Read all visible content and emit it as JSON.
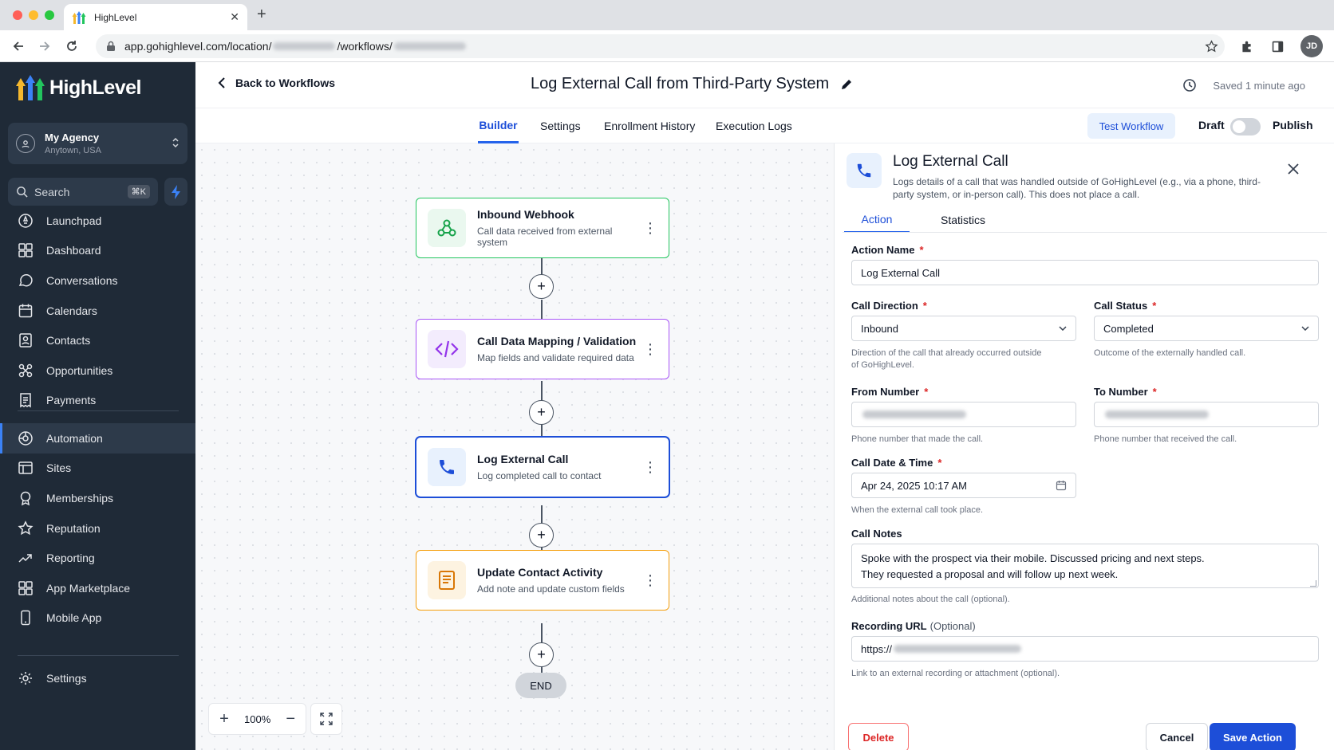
{
  "browser": {
    "tab_title": "HighLevel",
    "tab_close": "✕",
    "new_tab": "+",
    "url_prefix": "app.gohighlevel.com/location/",
    "url_middle": "/workflows/",
    "profile_initials": "JD"
  },
  "sidebar": {
    "brand": "HighLevel",
    "agency_name": "My Agency",
    "agency_location": "Anytown, USA",
    "search_label": "Search",
    "search_shortcut": "⌘K",
    "items_top": [
      {
        "label": "Launchpad",
        "icon": "launchpad-icon"
      },
      {
        "label": "Dashboard",
        "icon": "dashboard-icon"
      },
      {
        "label": "Conversations",
        "icon": "chat-icon"
      },
      {
        "label": "Calendars",
        "icon": "calendar-icon"
      },
      {
        "label": "Contacts",
        "icon": "contacts-icon"
      },
      {
        "label": "Opportunities",
        "icon": "opportunities-icon"
      },
      {
        "label": "Payments",
        "icon": "receipt-icon"
      }
    ],
    "items_mid": [
      {
        "label": "Automation",
        "icon": "automation-icon",
        "active": true
      },
      {
        "label": "Sites",
        "icon": "sites-icon"
      },
      {
        "label": "Memberships",
        "icon": "award-icon"
      },
      {
        "label": "Reputation",
        "icon": "star-icon"
      },
      {
        "label": "Reporting",
        "icon": "trend-icon"
      },
      {
        "label": "App Marketplace",
        "icon": "grid-icon"
      },
      {
        "label": "Mobile App",
        "icon": "mobile-icon"
      }
    ],
    "settings_label": "Settings"
  },
  "header": {
    "back_label": "Back to Workflows",
    "workflow_title": "Log External Call from Third-Party System",
    "saved_status": "Saved 1 minute ago"
  },
  "tabs": {
    "builder": "Builder",
    "settings": "Settings",
    "enrollment_history": "Enrollment History",
    "execution_logs": "Execution Logs",
    "test_workflow": "Test Workflow",
    "draft": "Draft",
    "publish": "Publish",
    "publish_state": "off"
  },
  "canvas": {
    "nodes": [
      {
        "title": "Inbound Webhook",
        "subtitle": "Call data received from external system",
        "icon": "webhook-icon",
        "color": "#22c55e",
        "bg": "#eaf8ef"
      },
      {
        "title": "Call Data Mapping / Validation",
        "subtitle": "Map fields and validate required data",
        "icon": "code-icon",
        "color": "#a855f7",
        "bg": "#f3ecfd"
      },
      {
        "title": "Log External Call",
        "subtitle": "Log completed call to contact",
        "icon": "phone-icon",
        "color": "#1d4ed8",
        "bg": "#e8f1fd"
      },
      {
        "title": "Update Contact Activity",
        "subtitle": "Add note and update custom fields",
        "icon": "note-icon",
        "color": "#f59e0b",
        "bg": "#fdf3e1"
      }
    ],
    "end_label": "END",
    "zoom_level": "100%",
    "plus_symbol": "+",
    "zoom_minus": "−",
    "kebab": "⋮"
  },
  "panel": {
    "title": "Log External Call",
    "description": "Logs details of a call that was handled outside of GoHighLevel (e.g., via a phone, third-party system, or in-person call). This does not place a call.",
    "tab_action": "Action",
    "tab_statistics": "Statistics",
    "required_mark": "*",
    "action_name": {
      "label": "Action Name",
      "value": "Log External Call"
    },
    "call_direction": {
      "label": "Call Direction",
      "value": "Inbound",
      "help": "Direction of the call that already occurred outside of GoHighLevel."
    },
    "call_status": {
      "label": "Call Status",
      "value": "Completed",
      "help": "Outcome of the externally handled call."
    },
    "from_number": {
      "label": "From Number",
      "help": "Phone number that made the call."
    },
    "to_number": {
      "label": "To Number",
      "help": "Phone number that received the call."
    },
    "call_datetime": {
      "label": "Call Date & Time",
      "value": "Apr 24, 2025 10:17 AM",
      "help": "When the external call took place."
    },
    "call_notes": {
      "label": "Call Notes",
      "value": "Spoke with the prospect via their mobile. Discussed pricing and next steps.\nThey requested a proposal and will follow up next week.",
      "help": "Additional notes about the call (optional)."
    },
    "recording_url": {
      "label": "Recording URL",
      "optional": "(Optional)",
      "value_prefix": "https://",
      "help": "Link to an external recording or attachment (optional)."
    },
    "delete_label": "Delete",
    "cancel_label": "Cancel",
    "save_label": "Save Action"
  }
}
